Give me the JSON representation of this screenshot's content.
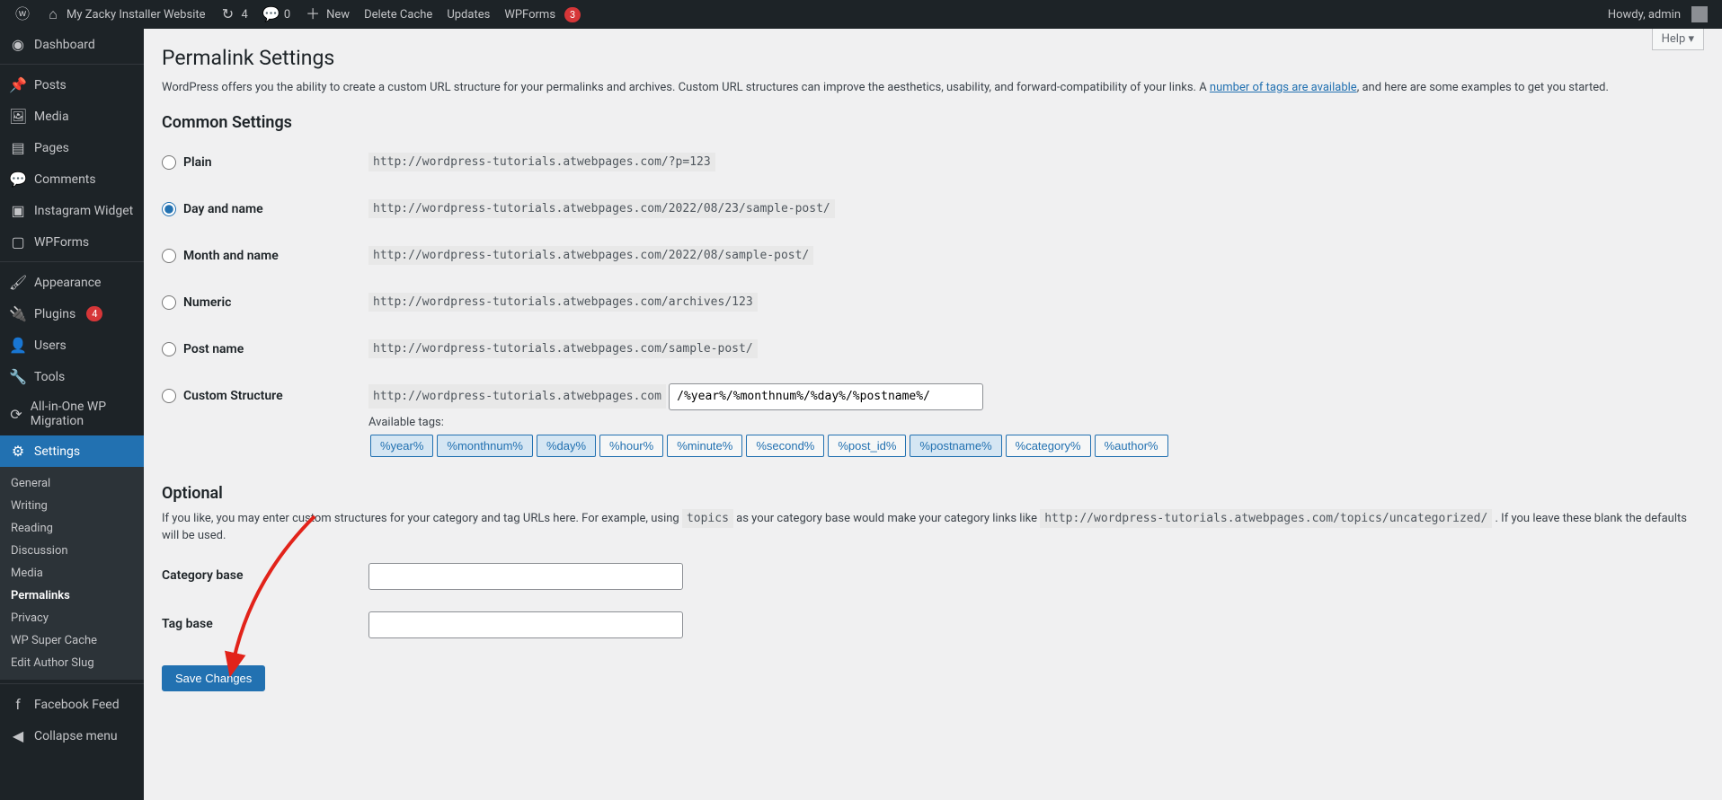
{
  "adminbar": {
    "site_title": "My Zacky Installer Website",
    "refresh_count": "4",
    "comment_count": "0",
    "new_label": "New",
    "delete_cache": "Delete Cache",
    "updates": "Updates",
    "wpforms_label": "WPForms",
    "wpforms_badge": "3",
    "howdy": "Howdy, admin"
  },
  "sidebar": {
    "items": [
      {
        "icon": "◉",
        "label": "Dashboard"
      },
      {
        "icon": "📌",
        "label": "Posts"
      },
      {
        "icon": "🖼",
        "label": "Media"
      },
      {
        "icon": "▤",
        "label": "Pages"
      },
      {
        "icon": "💬",
        "label": "Comments"
      },
      {
        "icon": "▣",
        "label": "Instagram Widget"
      },
      {
        "icon": "▢",
        "label": "WPForms"
      },
      {
        "icon": "🖌",
        "label": "Appearance"
      },
      {
        "icon": "🔌",
        "label": "Plugins",
        "badge": "4"
      },
      {
        "icon": "👤",
        "label": "Users"
      },
      {
        "icon": "🔧",
        "label": "Tools"
      },
      {
        "icon": "⟳",
        "label": "All-in-One WP Migration"
      },
      {
        "icon": "⚙",
        "label": "Settings"
      }
    ],
    "submenu": [
      "General",
      "Writing",
      "Reading",
      "Discussion",
      "Media",
      "Permalinks",
      "Privacy",
      "WP Super Cache",
      "Edit Author Slug"
    ],
    "facebook": "Facebook Feed",
    "collapse": "Collapse menu"
  },
  "page": {
    "help": "Help ▾",
    "title": "Permalink Settings",
    "intro_a": "WordPress offers you the ability to create a custom URL structure for your permalinks and archives. Custom URL structures can improve the aesthetics, usability, and forward-compatibility of your links. A ",
    "intro_link": "number of tags are available",
    "intro_b": ", and here are some examples to get you started.",
    "common_heading": "Common Settings",
    "options": [
      {
        "label": "Plain",
        "sample": "http://wordpress-tutorials.atwebpages.com/?p=123",
        "checked": false
      },
      {
        "label": "Day and name",
        "sample": "http://wordpress-tutorials.atwebpages.com/2022/08/23/sample-post/",
        "checked": true
      },
      {
        "label": "Month and name",
        "sample": "http://wordpress-tutorials.atwebpages.com/2022/08/sample-post/",
        "checked": false
      },
      {
        "label": "Numeric",
        "sample": "http://wordpress-tutorials.atwebpages.com/archives/123",
        "checked": false
      },
      {
        "label": "Post name",
        "sample": "http://wordpress-tutorials.atwebpages.com/sample-post/",
        "checked": false
      }
    ],
    "custom_label": "Custom Structure",
    "custom_prefix": "http://wordpress-tutorials.atwebpages.com",
    "custom_value": "/%year%/%monthnum%/%day%/%postname%/",
    "available_tags_label": "Available tags:",
    "tags": [
      {
        "t": "%year%",
        "a": true
      },
      {
        "t": "%monthnum%",
        "a": true
      },
      {
        "t": "%day%",
        "a": true
      },
      {
        "t": "%hour%",
        "a": false
      },
      {
        "t": "%minute%",
        "a": false
      },
      {
        "t": "%second%",
        "a": false
      },
      {
        "t": "%post_id%",
        "a": false
      },
      {
        "t": "%postname%",
        "a": true
      },
      {
        "t": "%category%",
        "a": false
      },
      {
        "t": "%author%",
        "a": false
      }
    ],
    "optional_heading": "Optional",
    "optional_a": "If you like, you may enter custom structures for your category and tag URLs here. For example, using ",
    "optional_code1": "topics",
    "optional_b": " as your category base would make your category links like ",
    "optional_code2": "http://wordpress-tutorials.atwebpages.com/topics/uncategorized/",
    "optional_c": " . If you leave these blank the defaults will be used.",
    "category_base": "Category base",
    "tag_base": "Tag base",
    "save": "Save Changes"
  }
}
